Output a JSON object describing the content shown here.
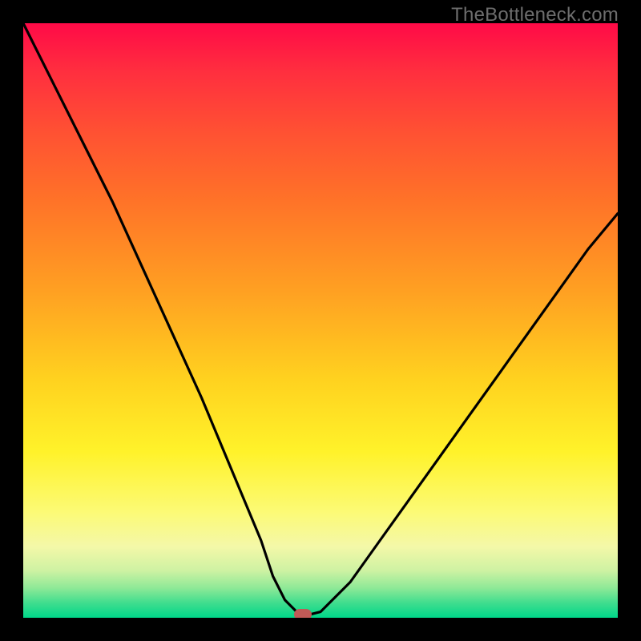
{
  "watermark": "TheBottleneck.com",
  "colors": {
    "frame": "#000000",
    "curve": "#000000",
    "marker": "#c05a57",
    "watermark_text": "#6d6d6d"
  },
  "chart_data": {
    "type": "line",
    "title": "",
    "xlabel": "",
    "ylabel": "",
    "xlim": [
      0,
      100
    ],
    "ylim": [
      0,
      100
    ],
    "x": [
      0,
      5,
      10,
      15,
      20,
      25,
      30,
      35,
      40,
      42,
      44,
      46,
      47,
      48,
      50,
      55,
      60,
      65,
      70,
      75,
      80,
      85,
      90,
      95,
      100
    ],
    "values": [
      100,
      90,
      80,
      70,
      59,
      48,
      37,
      25,
      13,
      7,
      3,
      1,
      0.5,
      0.5,
      1,
      6,
      13,
      20,
      27,
      34,
      41,
      48,
      55,
      62,
      68
    ],
    "series": [
      {
        "name": "bottleneck-curve",
        "x_ref": "x",
        "y_ref": "values"
      }
    ],
    "marker": {
      "x": 47,
      "y": 0.5
    },
    "annotations": []
  }
}
